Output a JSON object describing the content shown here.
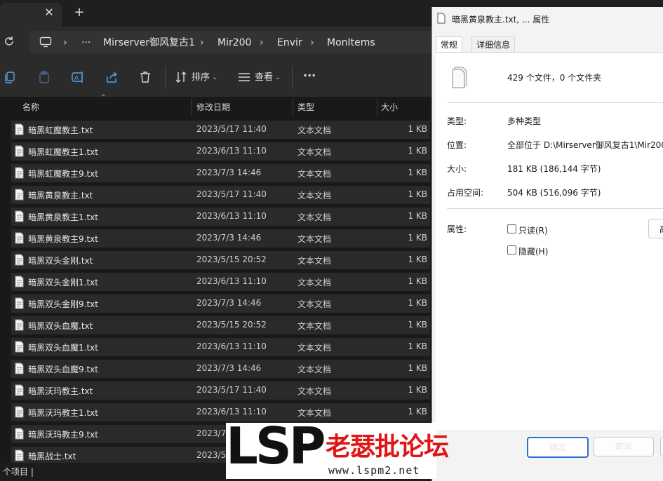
{
  "explorer": {
    "breadcrumb": [
      "Mirserver御风复古1",
      "Mir200",
      "Envir",
      "MonItems"
    ],
    "ellipsis": "···",
    "commands": {
      "sort": "排序",
      "view": "查看",
      "more": "···"
    },
    "columns": {
      "name": "名称",
      "date": "修改日期",
      "type": "类型",
      "size": "大小"
    },
    "files": [
      {
        "name": "暗黑虹魔教主.txt",
        "date": "2023/5/17 11:40",
        "type": "文本文档",
        "size": "1 KB"
      },
      {
        "name": "暗黑虹魔教主1.txt",
        "date": "2023/6/13 11:10",
        "type": "文本文档",
        "size": "1 KB"
      },
      {
        "name": "暗黑虹魔教主9.txt",
        "date": "2023/7/3 14:46",
        "type": "文本文档",
        "size": "1 KB"
      },
      {
        "name": "暗黑黄泉教主.txt",
        "date": "2023/5/17 11:40",
        "type": "文本文档",
        "size": "1 KB"
      },
      {
        "name": "暗黑黄泉教主1.txt",
        "date": "2023/6/13 11:10",
        "type": "文本文档",
        "size": "1 KB"
      },
      {
        "name": "暗黑黄泉教主9.txt",
        "date": "2023/7/3 14:46",
        "type": "文本文档",
        "size": "1 KB"
      },
      {
        "name": "暗黑双头金刚.txt",
        "date": "2023/5/15 20:52",
        "type": "文本文档",
        "size": "1 KB"
      },
      {
        "name": "暗黑双头金刚1.txt",
        "date": "2023/6/13 11:10",
        "type": "文本文档",
        "size": "1 KB"
      },
      {
        "name": "暗黑双头金刚9.txt",
        "date": "2023/7/3 14:46",
        "type": "文本文档",
        "size": "1 KB"
      },
      {
        "name": "暗黑双头血魔.txt",
        "date": "2023/5/15 20:52",
        "type": "文本文档",
        "size": "1 KB"
      },
      {
        "name": "暗黑双头血魔1.txt",
        "date": "2023/6/13 11:10",
        "type": "文本文档",
        "size": "1 KB"
      },
      {
        "name": "暗黑双头血魔9.txt",
        "date": "2023/7/3 14:46",
        "type": "文本文档",
        "size": "1 KB"
      },
      {
        "name": "暗黑沃玛教主.txt",
        "date": "2023/5/17 11:40",
        "type": "文本文档",
        "size": "1 KB"
      },
      {
        "name": "暗黑沃玛教主1.txt",
        "date": "2023/6/13 11:10",
        "type": "文本文档",
        "size": "1 KB"
      },
      {
        "name": "暗黑沃玛教主9.txt",
        "date": "2023/7/",
        "type": "文本文档",
        "size": "1 KB"
      },
      {
        "name": "暗黑战士.txt",
        "date": "2023/5/",
        "type": "文本文档",
        "size": "1 KB"
      }
    ],
    "status": "个项目"
  },
  "dialog": {
    "title": "暗黑黄泉教主.txt, ... 属性",
    "tabs": {
      "general": "常规",
      "details": "详细信息"
    },
    "summary": "429 个文件，0 个文件夹",
    "type_label": "类型:",
    "type_value": "多种类型",
    "location_label": "位置:",
    "location_value": "全部位于 D:\\Mirserver御风复古1\\Mir200",
    "size_label": "大小:",
    "size_value": "181 KB (186,144 字节)",
    "disk_label": "占用空间:",
    "disk_value": "504 KB (516,096 字节)",
    "attr_label": "属性:",
    "readonly": "只读(R)",
    "hidden": "隐藏(H)",
    "advanced": "高",
    "ok": "确定",
    "cancel": "取消"
  },
  "watermark": {
    "logo": "LSP",
    "site_name": "老瑟批论坛",
    "url": "www.lspm2.net"
  },
  "colors": {
    "accent": "#2a6fd1",
    "watermark_red": "#e01515"
  }
}
